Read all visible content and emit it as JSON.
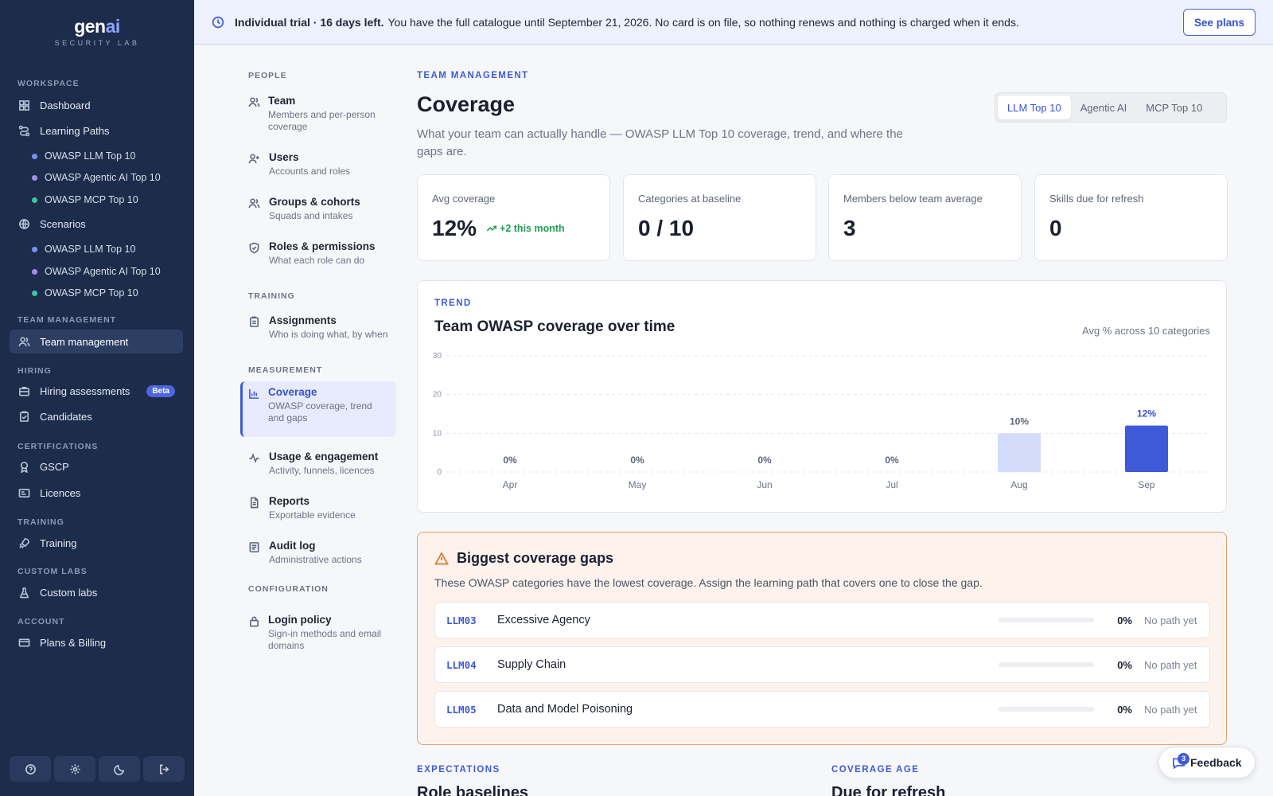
{
  "brand": {
    "name_main": "gen",
    "name_accent": "ai",
    "subtitle": "SECURITY LAB"
  },
  "sidebar": {
    "workspace_label": "WORKSPACE",
    "dashboard": "Dashboard",
    "learning_paths": "Learning Paths",
    "learning_paths_items": [
      {
        "label": "OWASP LLM Top 10",
        "color": "#7d8ff0"
      },
      {
        "label": "OWASP Agentic AI Top 10",
        "color": "#a58cf0"
      },
      {
        "label": "OWASP MCP Top 10",
        "color": "#3cc6a8"
      }
    ],
    "scenarios": "Scenarios",
    "scenario_items": [
      {
        "label": "OWASP LLM Top 10",
        "color": "#7d8ff0"
      },
      {
        "label": "OWASP Agentic AI Top 10",
        "color": "#a58cf0"
      },
      {
        "label": "OWASP MCP Top 10",
        "color": "#3cc6a8"
      }
    ],
    "team_management_label": "TEAM MANAGEMENT",
    "team_management": "Team management",
    "hiring_label": "HIRING",
    "hiring_assessments": "Hiring assessments",
    "beta_badge": "Beta",
    "candidates": "Candidates",
    "certifications_label": "CERTIFICATIONS",
    "gscp": "GSCP",
    "licences": "Licences",
    "training_label": "TRAINING",
    "training": "Training",
    "custom_labs_label": "CUSTOM LABS",
    "custom_labs": "Custom labs",
    "account_label": "ACCOUNT",
    "plans_billing": "Plans & Billing"
  },
  "banner": {
    "strong": "Individual trial · 16 days left.",
    "text": "You have the full catalogue until September 21, 2026. No card is on file, so nothing renews and nothing is charged when it ends.",
    "button": "See plans"
  },
  "subnav": {
    "people_label": "PEOPLE",
    "training_label": "TRAINING",
    "measurement_label": "MEASUREMENT",
    "configuration_label": "CONFIGURATION",
    "items": {
      "team": {
        "title": "Team",
        "desc": "Members and per-person coverage"
      },
      "users": {
        "title": "Users",
        "desc": "Accounts and roles"
      },
      "groups": {
        "title": "Groups & cohorts",
        "desc": "Squads and intakes"
      },
      "roles": {
        "title": "Roles & permissions",
        "desc": "What each role can do"
      },
      "assignments": {
        "title": "Assignments",
        "desc": "Who is doing what, by when"
      },
      "coverage": {
        "title": "Coverage",
        "desc": "OWASP coverage, trend and gaps"
      },
      "usage": {
        "title": "Usage & engagement",
        "desc": "Activity, funnels, licences"
      },
      "reports": {
        "title": "Reports",
        "desc": "Exportable evidence"
      },
      "audit": {
        "title": "Audit log",
        "desc": "Administrative actions"
      },
      "login": {
        "title": "Login policy",
        "desc": "Sign-in methods and email domains"
      }
    }
  },
  "main": {
    "eyebrow": "TEAM MANAGEMENT",
    "title": "Coverage",
    "description": "What your team can actually handle — OWASP LLM Top 10 coverage, trend, and where the gaps are.",
    "tabs": [
      "LLM Top 10",
      "Agentic AI",
      "MCP Top 10"
    ],
    "active_tab": "LLM Top 10",
    "stats": [
      {
        "label": "Avg coverage",
        "value": "12%",
        "delta": "+2 this month"
      },
      {
        "label": "Categories at baseline",
        "value": "0 / 10"
      },
      {
        "label": "Members below team average",
        "value": "3"
      },
      {
        "label": "Skills due for refresh",
        "value": "0"
      }
    ],
    "trend": {
      "eyebrow": "TREND",
      "title": "Team OWASP coverage over time",
      "note": "Avg % across 10 categories"
    },
    "gaps": {
      "title": "Biggest coverage gaps",
      "description": "These OWASP categories have the lowest coverage. Assign the learning path that covers one to close the gap.",
      "rows": [
        {
          "code": "LLM03",
          "name": "Excessive Agency",
          "coverage": 0,
          "pct": "0%",
          "path": "No path yet"
        },
        {
          "code": "LLM04",
          "name": "Supply Chain",
          "coverage": 0,
          "pct": "0%",
          "path": "No path yet"
        },
        {
          "code": "LLM05",
          "name": "Data and Model Poisoning",
          "coverage": 0,
          "pct": "0%",
          "path": "No path yet"
        }
      ]
    },
    "expectations": {
      "eyebrow": "EXPECTATIONS",
      "title": "Role baselines"
    },
    "coverage_age": {
      "eyebrow": "COVERAGE AGE",
      "title": "Due for refresh"
    }
  },
  "feedback": {
    "label": "Feedback",
    "count": "3"
  },
  "chart_data": {
    "type": "bar",
    "categories": [
      "Apr",
      "May",
      "Jun",
      "Jul",
      "Aug",
      "Sep"
    ],
    "values": [
      0,
      0,
      0,
      0,
      10,
      12
    ],
    "data_labels": [
      "0%",
      "0%",
      "0%",
      "0%",
      "10%",
      "12%"
    ],
    "yticks": [
      "0",
      "10",
      "20",
      "30"
    ],
    "ylim": [
      0,
      30
    ],
    "grid": true,
    "bar_colors": {
      "current": "#3f5ad8",
      "previous": "#d3dcfa"
    }
  }
}
